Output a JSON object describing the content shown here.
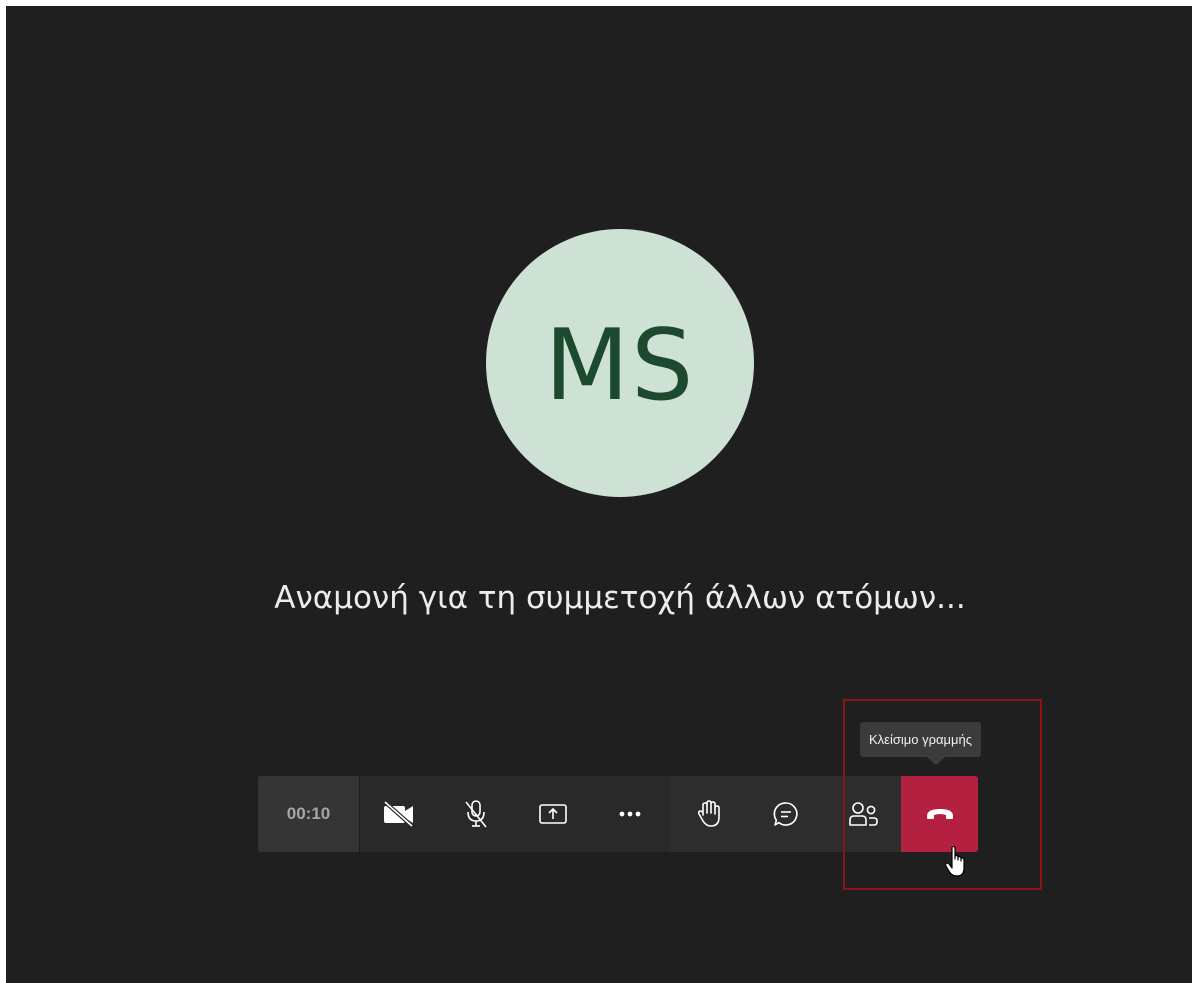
{
  "participant": {
    "initials": "MS"
  },
  "status": {
    "text": "Αναμονή για τη συμμετοχή άλλων ατόμων..."
  },
  "toolbar": {
    "timer": "00:10",
    "buttons": [
      {
        "icon": "camera-off-icon"
      },
      {
        "icon": "mic-off-icon"
      },
      {
        "icon": "share-screen-icon"
      },
      {
        "icon": "more-options-icon"
      },
      {
        "icon": "raise-hand-icon"
      },
      {
        "icon": "chat-icon"
      },
      {
        "icon": "participants-icon"
      },
      {
        "icon": "hang-up-icon"
      }
    ]
  },
  "tooltip": {
    "text": "Κλείσιμο γραμμής"
  },
  "colors": {
    "background": "#1f1f1f",
    "avatar_bg": "#cde1d5",
    "avatar_text": "#1d4a2e",
    "hangup": "#b4203f",
    "highlight": "#8b1414"
  }
}
